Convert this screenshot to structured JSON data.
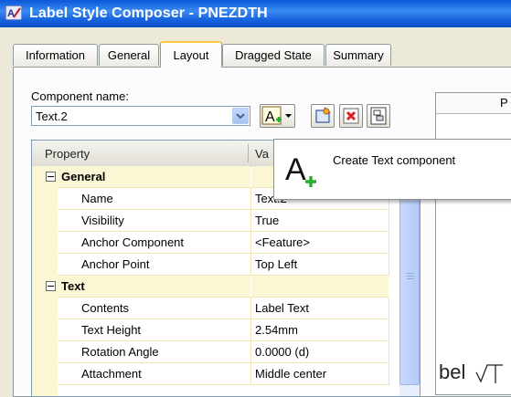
{
  "window": {
    "title": "Label Style Composer - PNEZDTH"
  },
  "tabs": [
    {
      "label": "Information"
    },
    {
      "label": "General"
    },
    {
      "label": "Layout",
      "active": true
    },
    {
      "label": "Dragged State"
    },
    {
      "label": "Summary"
    }
  ],
  "component": {
    "label": "Component name:",
    "value": "Text.2"
  },
  "toolbar": {
    "create_text_tooltip": "Create Text component"
  },
  "grid": {
    "headers": {
      "property": "Property",
      "value": "Va"
    },
    "rows": [
      {
        "type": "category",
        "label": "General"
      },
      {
        "type": "prop",
        "property": "Name",
        "value": "Text.2"
      },
      {
        "type": "prop",
        "property": "Visibility",
        "value": "True"
      },
      {
        "type": "prop",
        "property": "Anchor Component",
        "value": "<Feature>"
      },
      {
        "type": "prop",
        "property": "Anchor Point",
        "value": "Top Left"
      },
      {
        "type": "category",
        "label": "Text"
      },
      {
        "type": "prop",
        "property": "Contents",
        "value": "Label Text"
      },
      {
        "type": "prop",
        "property": "Text Height",
        "value": "2.54mm"
      },
      {
        "type": "prop",
        "property": "Rotation Angle",
        "value": "0.0000 (d)"
      },
      {
        "type": "prop",
        "property": "Attachment",
        "value": "Middle center"
      }
    ]
  },
  "preview": {
    "header_partial": "P",
    "sample_text": "bel"
  },
  "colors": {
    "title_bar": "#0a58d8",
    "active_tab_accent": "#ffc83c",
    "category_band": "#fbf6d4",
    "delete_red": "#e02020",
    "plus_green": "#22b030"
  }
}
